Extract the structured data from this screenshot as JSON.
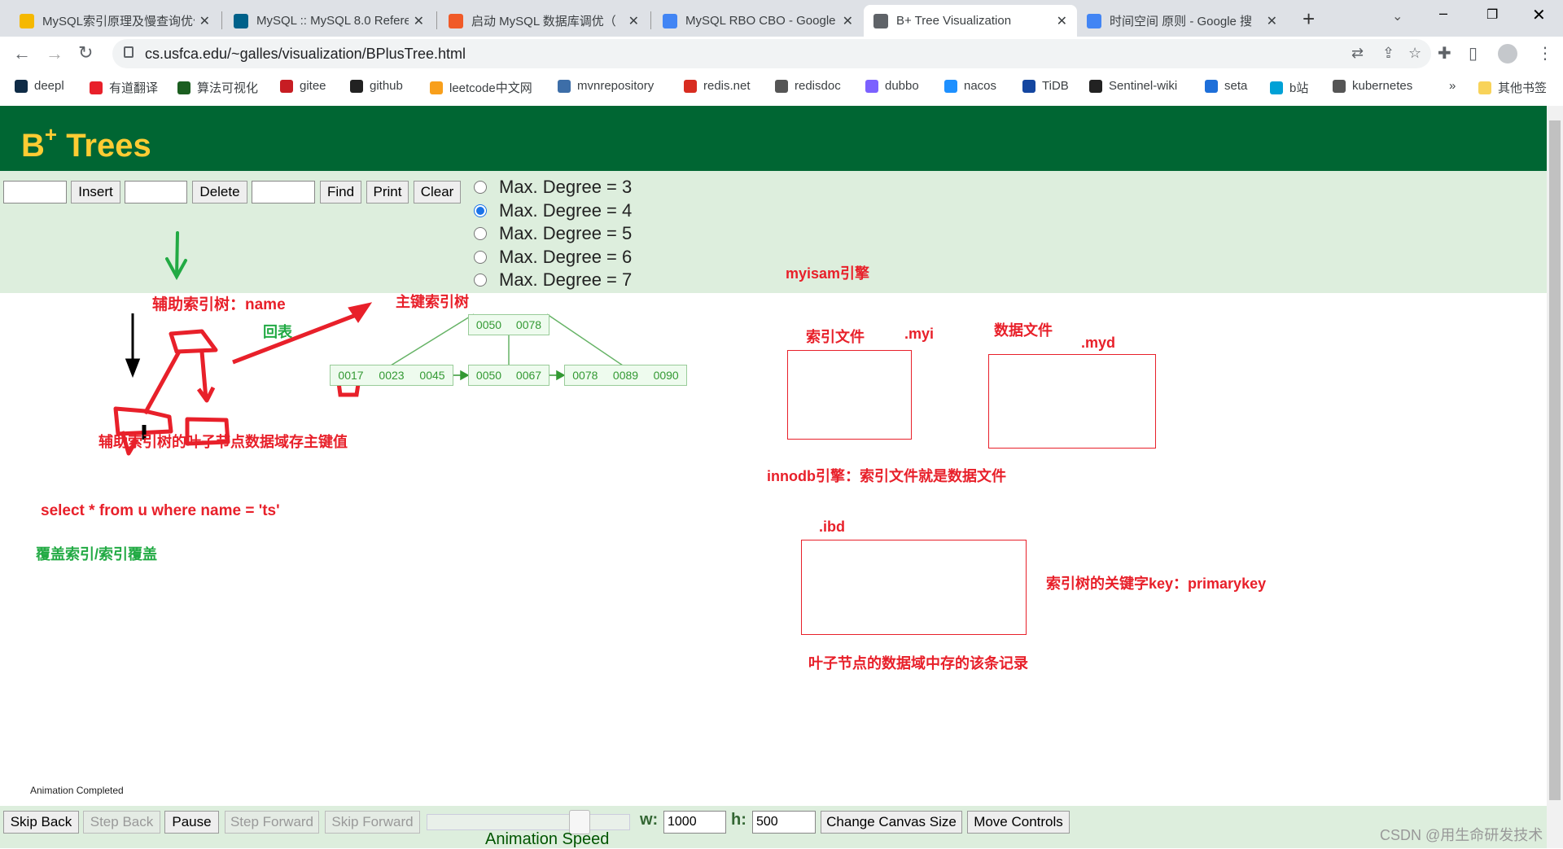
{
  "browser": {
    "tabs": [
      {
        "title": "MySQL索引原理及慢查询优化",
        "icon": "csdn-icon",
        "color": "#f5b800"
      },
      {
        "title": "MySQL :: MySQL 8.0 Reference",
        "icon": "mysql-icon",
        "color": "#00618a"
      },
      {
        "title": "启动 MySQL 数据库调优（",
        "icon": "video-icon",
        "color": "#f05a28"
      },
      {
        "title": "MySQL RBO CBO - Google",
        "icon": "google-icon",
        "color": "#4285f4"
      },
      {
        "title": "B+ Tree Visualization",
        "icon": "globe-icon",
        "color": "#5f6368"
      },
      {
        "title": "时间空间 原则 - Google 搜",
        "icon": "google-icon",
        "color": "#4285f4"
      }
    ],
    "active_tab": 4,
    "url": "cs.usfca.edu/~galles/visualization/BPlusTree.html",
    "bookmarks": [
      {
        "label": "deepl",
        "color": "#0f2b46"
      },
      {
        "label": "有道翻译",
        "color": "#e8202a"
      },
      {
        "label": "算法可视化",
        "color": "#1b5e20"
      },
      {
        "label": "gitee",
        "color": "#c71d23"
      },
      {
        "label": "github",
        "color": "#222"
      },
      {
        "label": "leetcode中文网",
        "color": "#f89f1b"
      },
      {
        "label": "mvnrepository",
        "color": "#3d6ea8"
      },
      {
        "label": "redis.net",
        "color": "#d82c20"
      },
      {
        "label": "redisdoc",
        "color": "#555"
      },
      {
        "label": "dubbo",
        "color": "#7b61ff"
      },
      {
        "label": "nacos",
        "color": "#1e90ff"
      },
      {
        "label": "TiDB",
        "color": "#1446a0"
      },
      {
        "label": "Sentinel-wiki",
        "color": "#222"
      },
      {
        "label": "seta",
        "color": "#1e6fd9"
      },
      {
        "label": "b站",
        "color": "#00a1d6"
      },
      {
        "label": "kubernetes",
        "color": "#555"
      }
    ],
    "more_bookmarks": "»",
    "other_bookmarks": "其他书签"
  },
  "page": {
    "title": "B",
    "title_sup": "+",
    "title_rest": " Trees",
    "controls": {
      "insert": "Insert",
      "delete": "Delete",
      "find": "Find",
      "print": "Print",
      "clear": "Clear",
      "insert_value": "",
      "delete_value": "",
      "find_value": ""
    },
    "degrees": [
      "Max. Degree = 3",
      "Max. Degree = 4",
      "Max. Degree = 5",
      "Max. Degree = 6",
      "Max. Degree = 7"
    ],
    "selected_degree": 1,
    "tree": {
      "root": [
        "0050",
        "0078"
      ],
      "leaves": [
        [
          "0017",
          "0023",
          "0045"
        ],
        [
          "0050",
          "0067"
        ],
        [
          "0078",
          "0089",
          "0090"
        ]
      ]
    },
    "annotations": {
      "myisam": "myisam引擎",
      "secondary": "辅助索引树：name",
      "primary": "主键索引树",
      "back": "回表",
      "leaf_note": "辅助索引树的叶子节点数据域存主键值",
      "sql": "select  *  from u where name = 'ts'",
      "covering": "覆盖索引/索引覆盖",
      "index_file": "索引文件",
      "myi": ".myi",
      "data_file": "数据文件",
      "myd": ".myd",
      "innodb": "innodb引擎：索引文件就是数据文件",
      "ibd": ".ibd",
      "key": "索引树的关键字key：primarykey",
      "record": "叶子节点的数据域中存的该条记录"
    },
    "status": "Animation Completed",
    "bottom": {
      "skip_back": "Skip Back",
      "step_back": "Step Back",
      "pause": "Pause",
      "step_forward": "Step Forward",
      "skip_forward": "Skip Forward",
      "w_label": "w:",
      "w_value": "1000",
      "h_label": "h:",
      "h_value": "500",
      "change_canvas": "Change Canvas Size",
      "move_controls": "Move Controls",
      "speed_label": "Animation Speed",
      "speed": 0.75
    },
    "watermark": "CSDN @用生命研发技术"
  }
}
